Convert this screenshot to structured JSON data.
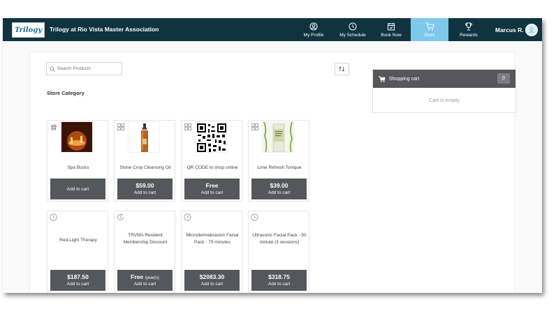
{
  "header": {
    "logo_text": "Trilogy",
    "org_name": "Trilogy at Rio Vista Master Association",
    "nav": [
      {
        "label": "My Profile",
        "icon": "user-circle-icon"
      },
      {
        "label": "My Schedule",
        "icon": "clock-icon"
      },
      {
        "label": "Book Now",
        "icon": "calendar-check-icon"
      },
      {
        "label": "Store",
        "icon": "cart-icon",
        "active": true
      },
      {
        "label": "Rewards",
        "icon": "trophy-icon"
      }
    ],
    "user_name": "Marcus R."
  },
  "search": {
    "placeholder": "Search Products"
  },
  "store_category_label": "Store Category",
  "cart": {
    "title": "Shopping cart",
    "count": "0",
    "empty_text": "Cart is empty"
  },
  "products": [
    {
      "name": "Spa Bucks",
      "price": "",
      "action": "Add to cart",
      "badge": "gift-icon"
    },
    {
      "name": "Stone Crop Cleansing Oil",
      "price": "$59.00",
      "action": "Add to cart",
      "badge": "grid-icon"
    },
    {
      "name": "QR CODE to shop online",
      "price": "Free",
      "action": "Add to cart",
      "badge": "grid-icon"
    },
    {
      "name": "Lime Refresh Tonique",
      "price": "$39.00",
      "action": "Add to cart",
      "badge": "grid-icon"
    },
    {
      "name": "Red-Light Therapy",
      "price": "$187.50",
      "action": "Add to cart",
      "badge": "clock-icon"
    },
    {
      "name": "TRVMA Resident Membership Discount",
      "price": "Free",
      "price_unit": "/year(s)",
      "action": "Add to cart",
      "badge": "refresh-clock-icon"
    },
    {
      "name": "Microdermabrasion Facial Pack - 75 minutes",
      "price": "$2083.30",
      "action": "Add to cart",
      "badge": "clock-icon"
    },
    {
      "name": "Ultrasonic Facial Pack - 50 minute (3 sessions)",
      "price": "$318.75",
      "action": "Add to cart",
      "badge": "clock-icon"
    }
  ],
  "colors": {
    "topbar": "#0f3440",
    "active_nav": "#7ec8ea",
    "button": "#54585c"
  }
}
